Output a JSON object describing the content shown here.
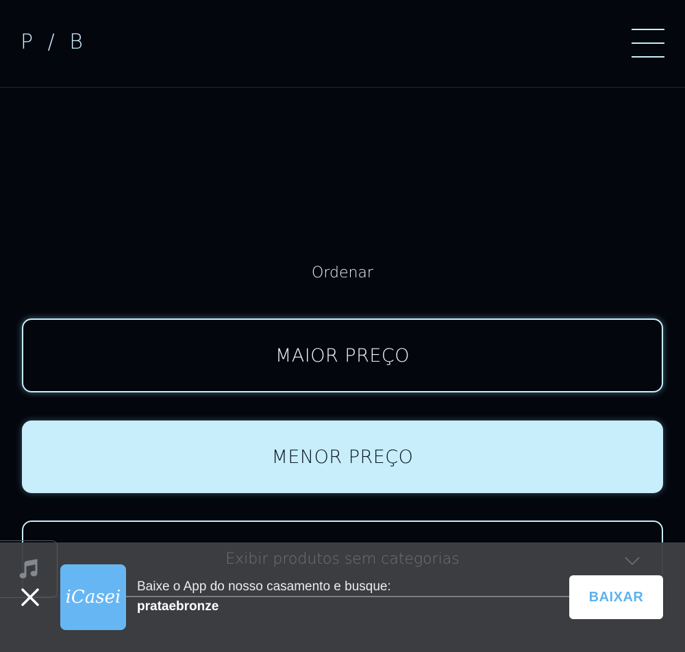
{
  "header": {
    "logo": "P / B"
  },
  "sort": {
    "heading": "Ordenar",
    "options": [
      {
        "label": "MAIOR PREÇO",
        "selected": false
      },
      {
        "label": "MENOR PREÇO",
        "selected": true
      },
      {
        "label": "Exibir produtos sem categorias",
        "selected": false
      }
    ]
  },
  "app_banner": {
    "app_logo_text": "iCasei",
    "message": "Baixe o App do nosso casamento e busque:",
    "event_name": "prataebronze",
    "download_label": "BAIXAR"
  },
  "colors": {
    "background": "#03060d",
    "accent": "#c8eefc",
    "banner": "#3e3f42",
    "app_blue": "#67b6f4"
  }
}
